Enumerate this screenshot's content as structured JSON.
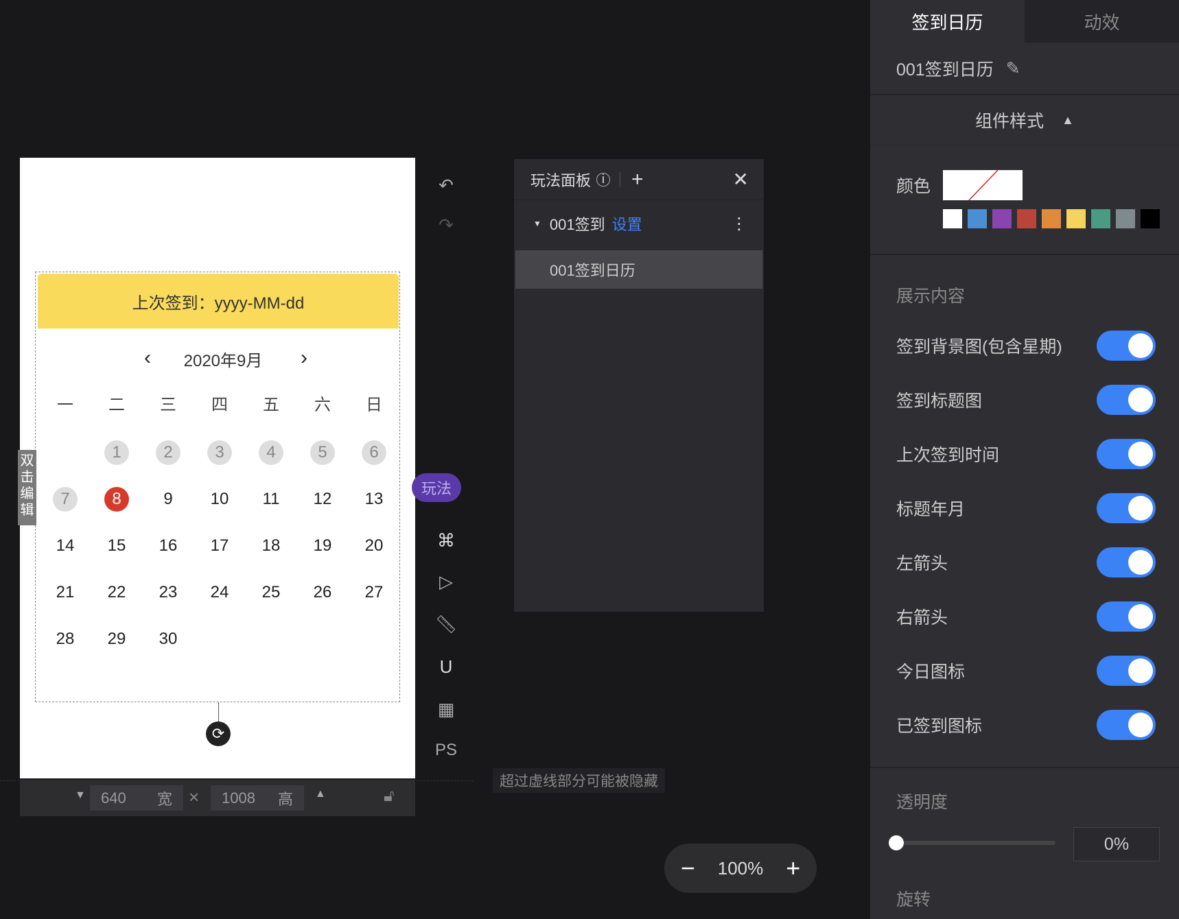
{
  "calendar": {
    "last_sign": "上次签到：yyyy-MM-dd",
    "month_title": "2020年9月",
    "prev_arrow": "‹",
    "next_arrow": "›",
    "weekdays": [
      "一",
      "二",
      "三",
      "四",
      "五",
      "六",
      "日"
    ],
    "rows": [
      [
        "",
        "1",
        "2",
        "3",
        "4",
        "5",
        "6"
      ],
      [
        "7",
        "8",
        "9",
        "10",
        "11",
        "12",
        "13"
      ],
      [
        "14",
        "15",
        "16",
        "17",
        "18",
        "19",
        "20"
      ],
      [
        "21",
        "22",
        "23",
        "24",
        "25",
        "26",
        "27"
      ],
      [
        "28",
        "29",
        "30",
        "",
        "",
        "",
        ""
      ]
    ],
    "signed_days": [
      "1",
      "2",
      "3",
      "4",
      "5",
      "6",
      "7"
    ],
    "today": "8",
    "today_color": "#d63a2a",
    "banner_color": "#f9da5b"
  },
  "canvas": {
    "double_click_edit": "双击编辑",
    "width_value": "640",
    "width_label": "宽",
    "height_value": "1008",
    "height_label": "高",
    "hint": "超过虚线部分可能被隐藏",
    "play_tag": "玩法",
    "tool_ps": "PS",
    "zoom_minus": "−",
    "zoom_value": "100%",
    "zoom_plus": "+"
  },
  "panel": {
    "title": "玩法面板",
    "item_name": "001签到",
    "item_link": "设置",
    "child_name": "001签到日历"
  },
  "sidebar": {
    "tabs": [
      "签到日历",
      "动效"
    ],
    "component_name": "001签到日历",
    "style_header": "组件样式",
    "color_label": "颜色",
    "swatches": [
      "#ffffff",
      "#4a8fd6",
      "#8a44b0",
      "#b8453a",
      "#e08a3c",
      "#f4d35e",
      "#4a9a84",
      "#7f8a8e",
      "#000000"
    ],
    "display_title": "展示内容",
    "toggles": [
      {
        "label": "签到背景图(包含星期)",
        "on": true
      },
      {
        "label": "签到标题图",
        "on": true
      },
      {
        "label": "上次签到时间",
        "on": true
      },
      {
        "label": "标题年月",
        "on": true
      },
      {
        "label": "左箭头",
        "on": true
      },
      {
        "label": "右箭头",
        "on": true
      },
      {
        "label": "今日图标",
        "on": true
      },
      {
        "label": "已签到图标",
        "on": true
      }
    ],
    "opacity_label": "透明度",
    "opacity_value": "0%",
    "opacity_fraction": 0,
    "rotate_label": "旋转"
  }
}
